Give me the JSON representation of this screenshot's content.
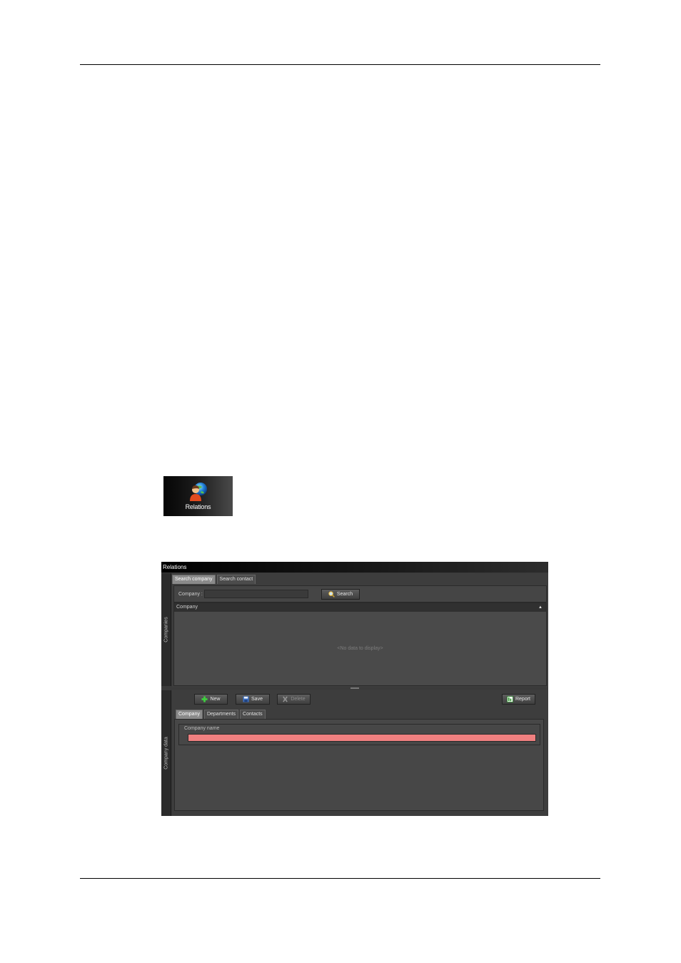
{
  "launcher": {
    "label": "Relations",
    "icon": "relations-icon"
  },
  "window": {
    "title": "Relations",
    "companies_panel": {
      "sidebar_label": "Companies",
      "tabs": [
        "Search company",
        "Search contact"
      ],
      "search_label": "Company :",
      "search_value": "",
      "search_button": "Search",
      "grid_header": "Company",
      "empty_text": "<No data to display>"
    },
    "data_panel": {
      "sidebar_label": "Company data",
      "toolbar": {
        "new": "New",
        "save": "Save",
        "delete": "Delete",
        "report": "Report"
      },
      "tabs": [
        "Company",
        "Departments",
        "Contacts"
      ],
      "field_label": "Company name",
      "field_value": "",
      "invalid_field_color": "#f08080"
    }
  }
}
